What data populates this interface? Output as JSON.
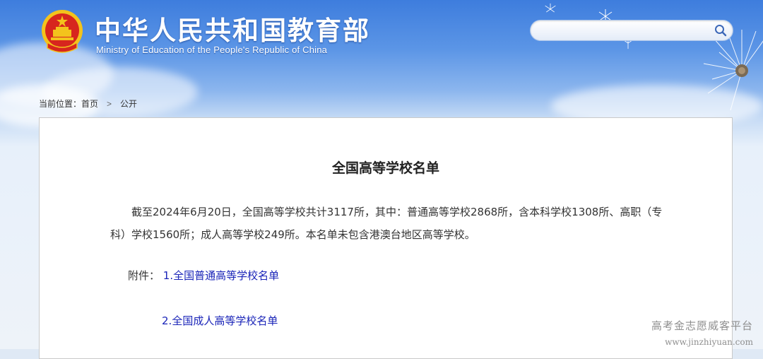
{
  "header": {
    "title_cn": "中华人民共和国教育部",
    "title_en": "Ministry of Education of the People's Republic of China",
    "emblem_icon": "national-emblem-icon"
  },
  "search": {
    "value": "",
    "placeholder": "",
    "icon": "search-icon"
  },
  "breadcrumb": {
    "prefix": "当前位置：",
    "items": [
      "首页",
      "公开"
    ],
    "separator": ">"
  },
  "article": {
    "title": "全国高等学校名单",
    "body": "截至2024年6月20日，全国高等学校共计3117所，其中：普通高等学校2868所，含本科学校1308所、高职（专科）学校1560所；成人高等学校249所。本名单未包含港澳台地区高等学校。",
    "attachments_label": "附件：",
    "attachments": [
      {
        "number": "1.",
        "label": "全国普通高等学校名单"
      },
      {
        "number": "2.",
        "label": "全国成人高等学校名单"
      }
    ]
  },
  "watermark": {
    "line1": "高考金志愿威客平台",
    "line2": "www.jinzhiyuan.com"
  },
  "colors": {
    "link": "#1a24b8",
    "header_blue": "#3e7ddd",
    "emblem_red": "#d7261e",
    "emblem_gold": "#f3c31c"
  }
}
